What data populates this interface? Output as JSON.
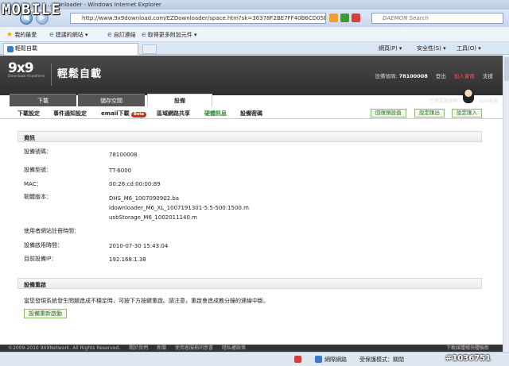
{
  "watermark": {
    "logo": "MOBILE",
    "id": "#1036751"
  },
  "browser": {
    "title": "...ownloader - Windows Internet Explorer",
    "address": "http://www.9x9download.com/EZDownloader/space.htm?sk=36378F2BE7FF40B6CD05EF1304BFDD50WS",
    "search_placeholder": "DAEMON Search",
    "favorites": [
      {
        "label": "我的最愛"
      },
      {
        "label": "建議的網站 ▾"
      },
      {
        "label": "自訂連結"
      },
      {
        "label": "取得更多附加元件 ▾"
      }
    ],
    "tab_label": "輕鬆自載",
    "commands": {
      "page": "網頁(P) ▾",
      "safety": "安全性(S) ▾",
      "tools": "工具(O) ▾"
    }
  },
  "site": {
    "logo": "9x9",
    "logo_sub": "Download Anywhere",
    "brand": "輕鬆自載",
    "device_label": "設備號碼:",
    "device_number": "78100008",
    "links": [
      "登出",
      "加入會員",
      "支援"
    ],
    "nav_tabs": [
      "下載",
      "儲存空間",
      "設備"
    ],
    "help": "您需要幫助嗎？",
    "service": "9x9客服"
  },
  "subnav": {
    "items": [
      "下載設定",
      "事件通知設定",
      "email下載",
      "區域網路共享",
      "硬體訊息",
      "設備密碼"
    ],
    "beta": "Beta",
    "buttons": [
      "回復預設值",
      "設定匯出",
      "設定匯入"
    ]
  },
  "info": {
    "title": "資訊",
    "rows": [
      {
        "label": "設備號碼：",
        "value": "78100008"
      },
      {
        "label": "設備型號：",
        "value": "TT-6000"
      },
      {
        "label": "MAC：",
        "value": "00:26:cd:00:00:89"
      },
      {
        "label": "韌體版本：",
        "value": "DHS_M6_1007090902.ba"
      },
      {
        "label": "",
        "value": "idownloader_M6_XL_1007191301-5.5-500:1500.m"
      },
      {
        "label": "",
        "value": "usbStorage_M6_1002011140.m"
      },
      {
        "label": "使用者網站註冊時間：",
        "value": ""
      },
      {
        "label": "設備啟用時間：",
        "value": "2010-07-30 15:43:04"
      },
      {
        "label": "目前設備IP：",
        "value": "192.168.1.38"
      }
    ]
  },
  "reset": {
    "title": "設備重啟",
    "note": "當您發現系統發生問題造成不穩定時，可按下方按鍵重啟。請注意，重啟會造成教分鐘的連線中斷。",
    "button": "設備重新啟動"
  },
  "footer": {
    "items": [
      "©2009-2010 9X9Network. All Rights Reserved.",
      "關於我們",
      "新聞",
      "使用者服務同意書",
      "隱私權政策"
    ],
    "right": "下載媒體暢快體驗新"
  },
  "statusbar": {
    "zone": "網際網路",
    "protected": "受保護模式：關閉"
  }
}
